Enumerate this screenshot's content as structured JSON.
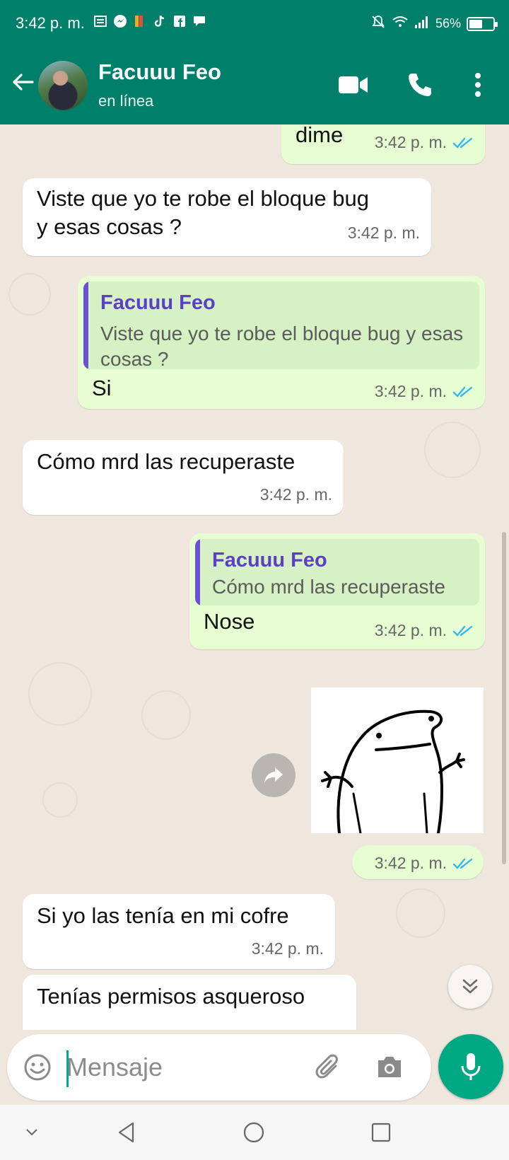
{
  "status_bar": {
    "time": "3:42 p. m.",
    "battery_percent": "56%",
    "battery_level": 0.56,
    "notification_icons": [
      "news-icon",
      "messenger-icon",
      "app-icon",
      "tiktok-icon",
      "facebook-icon",
      "chat-icon"
    ]
  },
  "header": {
    "contact_name": "Facuuu Feo",
    "contact_status": "en línea",
    "accent_color": "#00806a"
  },
  "messages": [
    {
      "direction": "out",
      "text": "dime",
      "time": "3:42 p. m.",
      "read": true
    },
    {
      "direction": "in",
      "text_lines": [
        "Viste que yo te robe el bloque bug",
        "y esas cosas ?"
      ],
      "time": "3:42 p. m."
    },
    {
      "direction": "out",
      "quote": {
        "author": "Facuuu Feo",
        "text": "Viste que yo te robe el bloque bug y esas cosas ?"
      },
      "text": "Si",
      "time": "3:42 p. m.",
      "read": true
    },
    {
      "direction": "in",
      "text": "Cómo mrd las recuperaste",
      "time": "3:42 p. m."
    },
    {
      "direction": "out",
      "quote": {
        "author": "Facuuu Feo",
        "text": "Cómo mrd las recuperaste"
      },
      "text": "Nose",
      "time": "3:42 p. m.",
      "read": true
    },
    {
      "direction": "out",
      "type": "sticker",
      "time": "3:42 p. m.",
      "read": true
    },
    {
      "direction": "in",
      "text": "Si yo las tenía en mi cofre",
      "time": "3:42 p. m."
    },
    {
      "direction": "in",
      "text": "Tenías permisos asqueroso"
    }
  ],
  "composer": {
    "placeholder": "Mensaje"
  },
  "colors": {
    "chat_background": "#efe7de",
    "outgoing_bubble": "#e6fed2",
    "incoming_bubble": "#ffffff",
    "read_tick": "#34b7f1",
    "quote_author": "#5b3fc7",
    "mic_button": "#00a884"
  }
}
